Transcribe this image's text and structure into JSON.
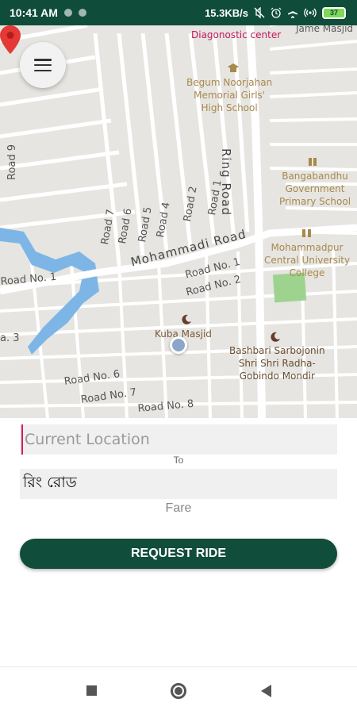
{
  "status_bar": {
    "time": "10:41 AM",
    "network_speed": "15.3KB/s",
    "battery": "37",
    "icons": [
      "notification-dot-icon",
      "notification-dot-icon",
      "no-sound-icon",
      "alarm-icon",
      "airplane-mode-icon",
      "hotspot-icon",
      "battery-icon"
    ]
  },
  "map": {
    "menu_icon": "menu-icon",
    "roads": {
      "ring_road": "Ring Road",
      "mohammadi_road": "Mohammadi Road",
      "road_9": "Road 9",
      "road_1_v": "Road 1",
      "road_2_v": "Road 2",
      "road_4_v": "Road 4",
      "road_5_v": "Road 5",
      "road_6_v": "Road 6",
      "road_7_v": "Road 7",
      "road_no_1_left": "Road No. 1",
      "road_no_1": "Road No. 1",
      "road_no_2": "Road No. 2",
      "road_3": "a. 3",
      "road_no_6": "Road No. 6",
      "road_no_7": "Road No. 7",
      "road_no_8": "Road No. 8"
    },
    "places": {
      "diagnostic_center": "Diagonostic center",
      "jame_masjid": "Jame Masjid",
      "school_1": "Begum Noorjahan\nMemorial Girls'\nHigh School",
      "school_2": "Bangabandhu\nGovernment\nPrimary School",
      "college": "Mohammadpur\nCentral University\nCollege",
      "mosque": "Kuba Masjid",
      "temple": "Bashbari Sarbojonin\nShri Shri Radha-\nGobindo Mondir"
    },
    "colors": {
      "water": "#7db6e6",
      "park": "#9ed38f",
      "road": "#ffffff",
      "block": "#dddcd7",
      "pin": "#e53935"
    }
  },
  "form": {
    "pickup_placeholder": "Current Location",
    "to_label": "To",
    "destination_value": "রিং রোড",
    "fare_label": "Fare",
    "request_button": "REQUEST RIDE"
  },
  "nav_bar": {
    "icons": [
      "recents-icon",
      "home-icon",
      "back-icon"
    ]
  },
  "colors": {
    "primary": "#114d3b",
    "status_bar": "#0f4d3a",
    "accent_cursor": "#d81b60"
  }
}
